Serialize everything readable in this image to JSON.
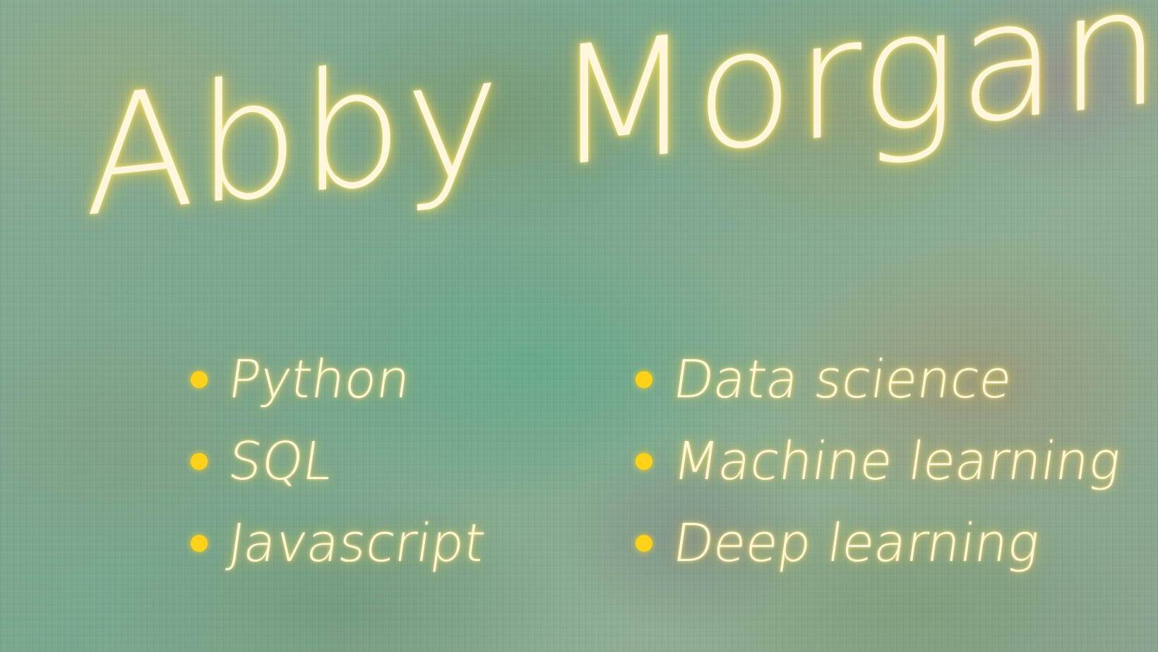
{
  "name": "Abby Morgan",
  "skills_left": [
    "Python",
    "SQL",
    "Javascript"
  ],
  "skills_right": [
    "Data science",
    "Machine learning",
    "Deep learning"
  ],
  "colors": {
    "text": "#fff7dc",
    "glow": "#ffd84a",
    "bullet": "#ffd21a",
    "background": "#7fa68f"
  }
}
